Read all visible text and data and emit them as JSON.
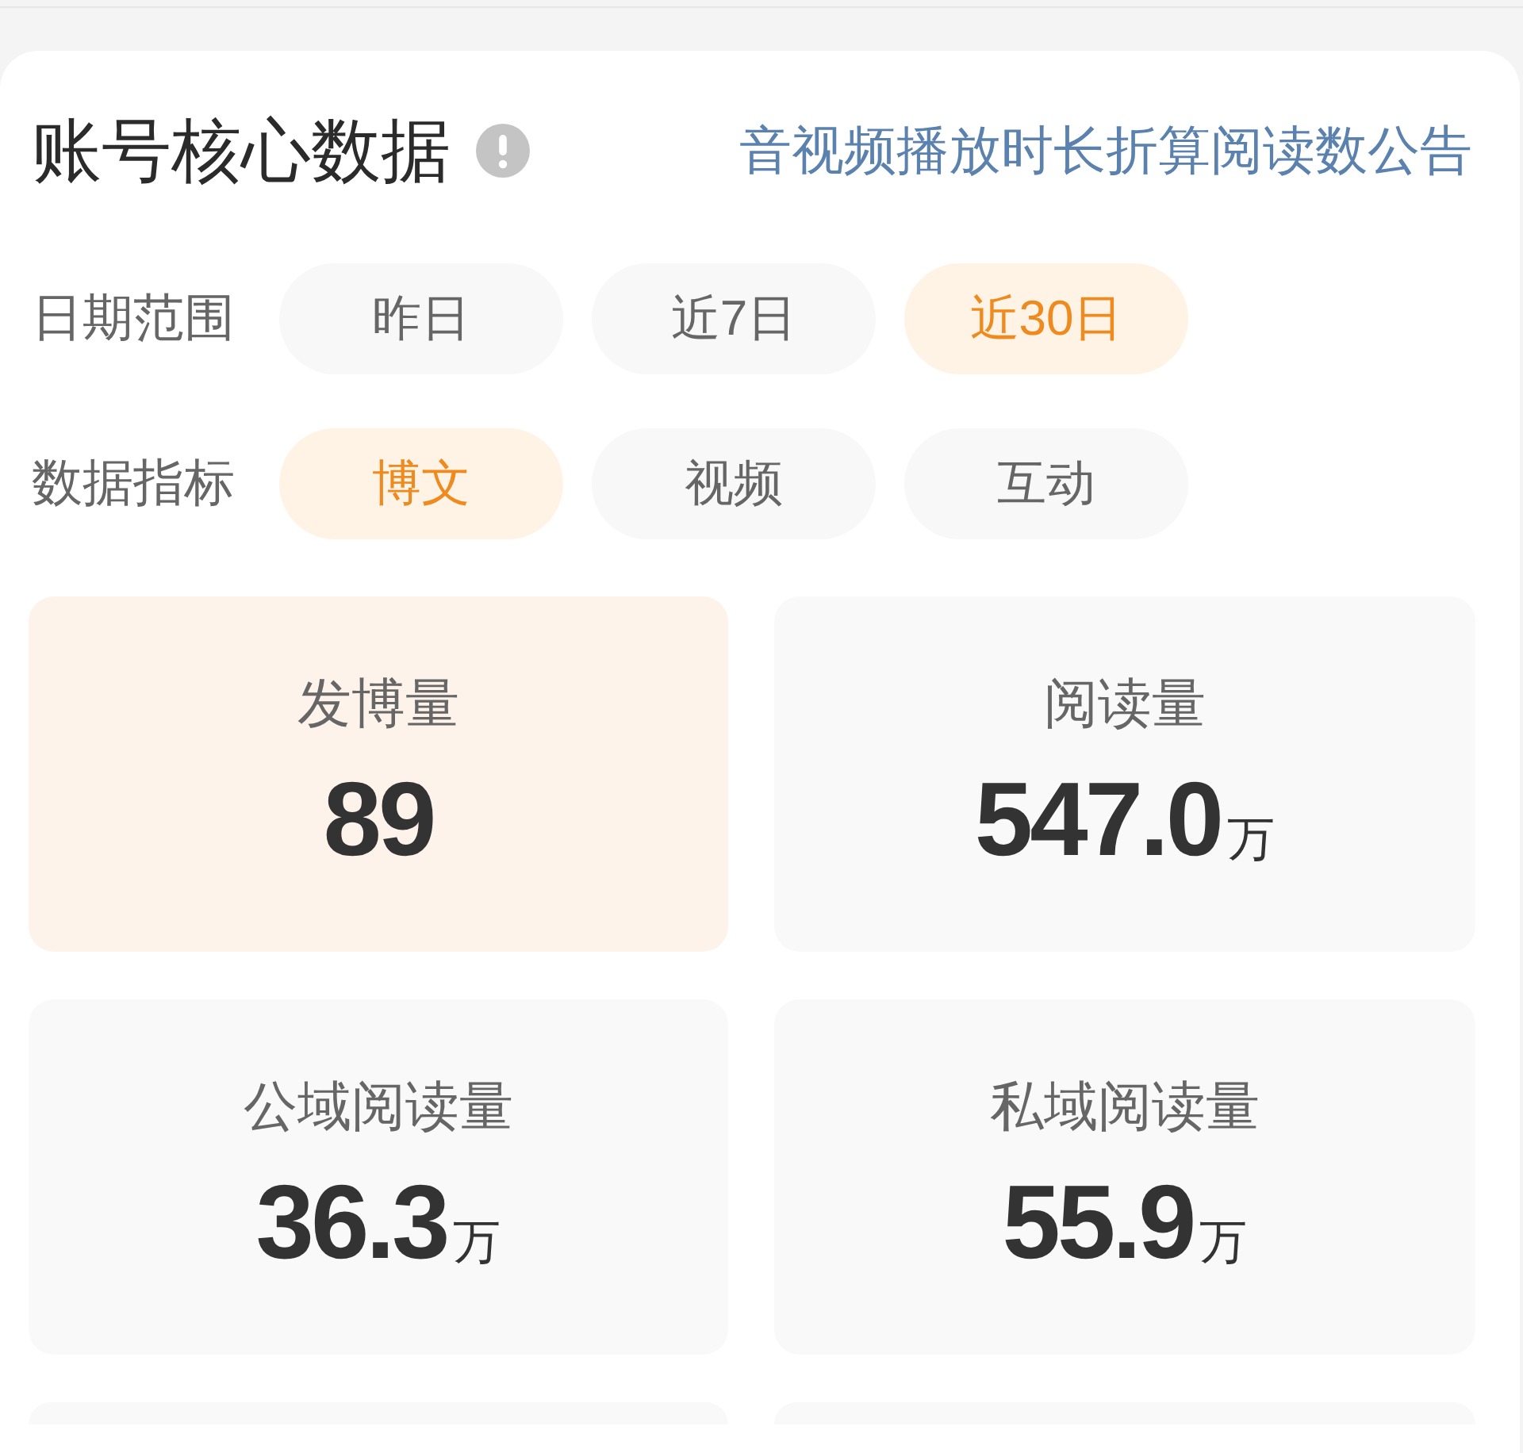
{
  "header": {
    "title": "账号核心数据",
    "notice_link": "音视频播放时长折算阅读数公告"
  },
  "filters": [
    {
      "label": "日期范围",
      "options": [
        {
          "label": "昨日",
          "selected": false
        },
        {
          "label": "近7日",
          "selected": false
        },
        {
          "label": "近30日",
          "selected": true
        }
      ]
    },
    {
      "label": "数据指标",
      "options": [
        {
          "label": "博文",
          "selected": true
        },
        {
          "label": "视频",
          "selected": false
        },
        {
          "label": "互动",
          "selected": false
        }
      ]
    }
  ],
  "metrics": [
    {
      "label": "发博量",
      "value": "89",
      "selected": true
    },
    {
      "label": "阅读量",
      "value": "547.0",
      "unit": "万",
      "selected": false
    },
    {
      "label": "公域阅读量",
      "value": "36.3",
      "unit": "万",
      "selected": false
    },
    {
      "label": "私域阅读量",
      "value": "55.9",
      "unit": "万",
      "selected": false
    }
  ]
}
